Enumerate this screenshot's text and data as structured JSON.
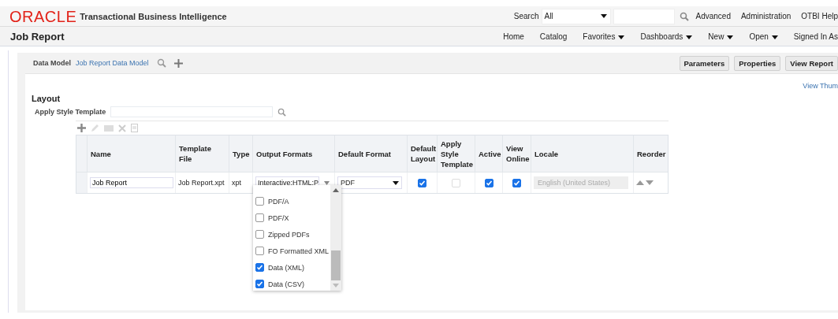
{
  "brand": {
    "logo": "ORACLE",
    "product": "Transactional Business Intelligence"
  },
  "global_search": {
    "label": "Search",
    "scope": "All",
    "links": [
      "Advanced",
      "Administration",
      "OTBI Help"
    ]
  },
  "page_title": "Job Report",
  "nav": [
    {
      "label": "Home",
      "menu": false
    },
    {
      "label": "Catalog",
      "menu": false
    },
    {
      "label": "Favorites",
      "menu": true
    },
    {
      "label": "Dashboards",
      "menu": true
    },
    {
      "label": "New",
      "menu": true
    },
    {
      "label": "Open",
      "menu": true
    },
    {
      "label": "Signed In As",
      "menu": false
    }
  ],
  "data_model": {
    "label": "Data Model",
    "link": "Job Report Data Model"
  },
  "actions": [
    "Parameters",
    "Properties",
    "View Report"
  ],
  "view_link": "View Thum",
  "section_title": "Layout",
  "style_template": {
    "label": "Apply Style Template"
  },
  "table": {
    "columns": [
      "Name",
      "Template File",
      "Type",
      "Output Formats",
      "Default Format",
      "Default Layout",
      "Apply Style Template",
      "Active",
      "View Online",
      "Locale",
      "Reorder"
    ],
    "rows": [
      {
        "name": "Job Report",
        "template_file": "Job Report.xpt",
        "type": "xpt",
        "output_formats": "Interactive;HTML;P",
        "default_format": "PDF",
        "default_layout": true,
        "apply_style_template": false,
        "active": true,
        "view_online": true,
        "locale": "English (United States)"
      }
    ]
  },
  "output_formats_menu": [
    {
      "label": "PDF/A",
      "checked": false
    },
    {
      "label": "PDF/X",
      "checked": false
    },
    {
      "label": "Zipped PDFs",
      "checked": false
    },
    {
      "label": "FO Formatted XML",
      "checked": false
    },
    {
      "label": "Data (XML)",
      "checked": true
    },
    {
      "label": "Data (CSV)",
      "checked": true
    }
  ]
}
